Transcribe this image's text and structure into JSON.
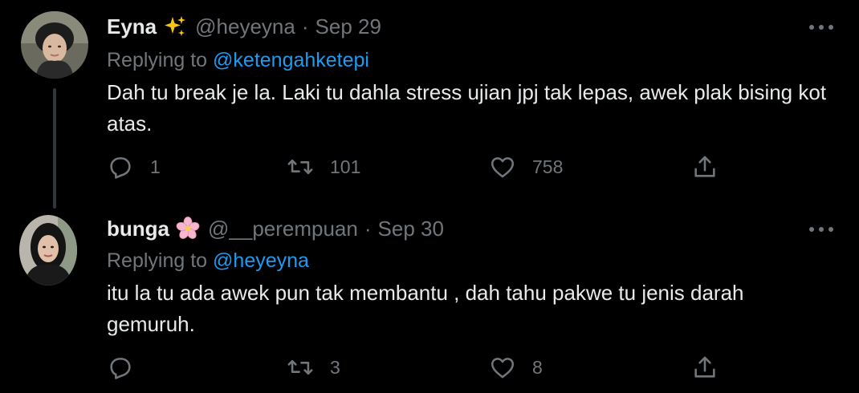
{
  "tweets": [
    {
      "display_name": "Eyna",
      "name_emoji": "sparkles-emoji",
      "handle": "@heyeyna",
      "separator": "·",
      "date": "Sep 29",
      "replying_prefix": "Replying to",
      "replying_to": "@ketengahketepi",
      "text": "Dah tu break je la. Laki tu dahla stress ujian jpj tak lepas, awek plak bising kot atas.",
      "counts": {
        "replies": "1",
        "retweets": "101",
        "likes": "758"
      }
    },
    {
      "display_name": "bunga",
      "name_emoji": "cherry-blossom-emoji",
      "handle": "@__perempuan",
      "separator": "·",
      "date": "Sep 30",
      "replying_prefix": "Replying to",
      "replying_to": "@heyeyna",
      "text": "itu la tu ada awek pun tak membantu , dah tahu pakwe tu jenis darah gemuruh.",
      "counts": {
        "replies": "",
        "retweets": "3",
        "likes": "8"
      }
    }
  ],
  "colors": {
    "background": "#000000",
    "text": "#e7e9ea",
    "muted": "#71767b",
    "link": "#1d9bf0",
    "thread_line": "#333639"
  },
  "icons": [
    "reply-icon",
    "retweet-icon",
    "like-icon",
    "share-icon",
    "more-icon"
  ]
}
